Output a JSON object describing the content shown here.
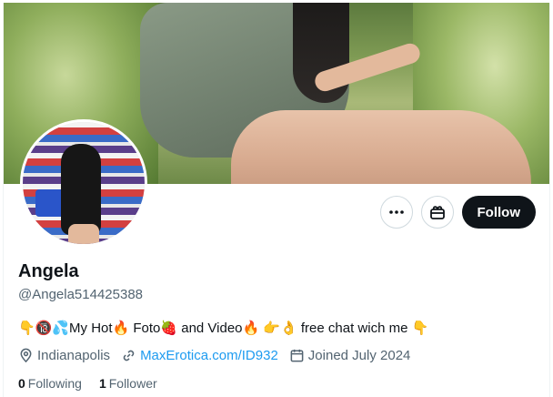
{
  "banner": {
    "alt": "Profile header photo"
  },
  "profile": {
    "name": "Angela",
    "handle": "@Angela514425388",
    "bio": "👇🔞💦My Hot🔥 Foto🍓 and Video🔥 👉👌 free chat wich me 👇",
    "location": "Indianapolis",
    "website": "MaxErotica.com/ID932",
    "joined": "Joined July 2024"
  },
  "actions": {
    "more_icon": "more-icon",
    "gift_icon": "gift-icon",
    "follow_label": "Follow"
  },
  "stats": {
    "following_count": "0",
    "following_label": "Following",
    "followers_count": "1",
    "followers_label": "Follower"
  },
  "colors": {
    "text": "#0f1419",
    "secondary": "#536471",
    "link": "#1d9bf0",
    "button": "#0f1419"
  }
}
